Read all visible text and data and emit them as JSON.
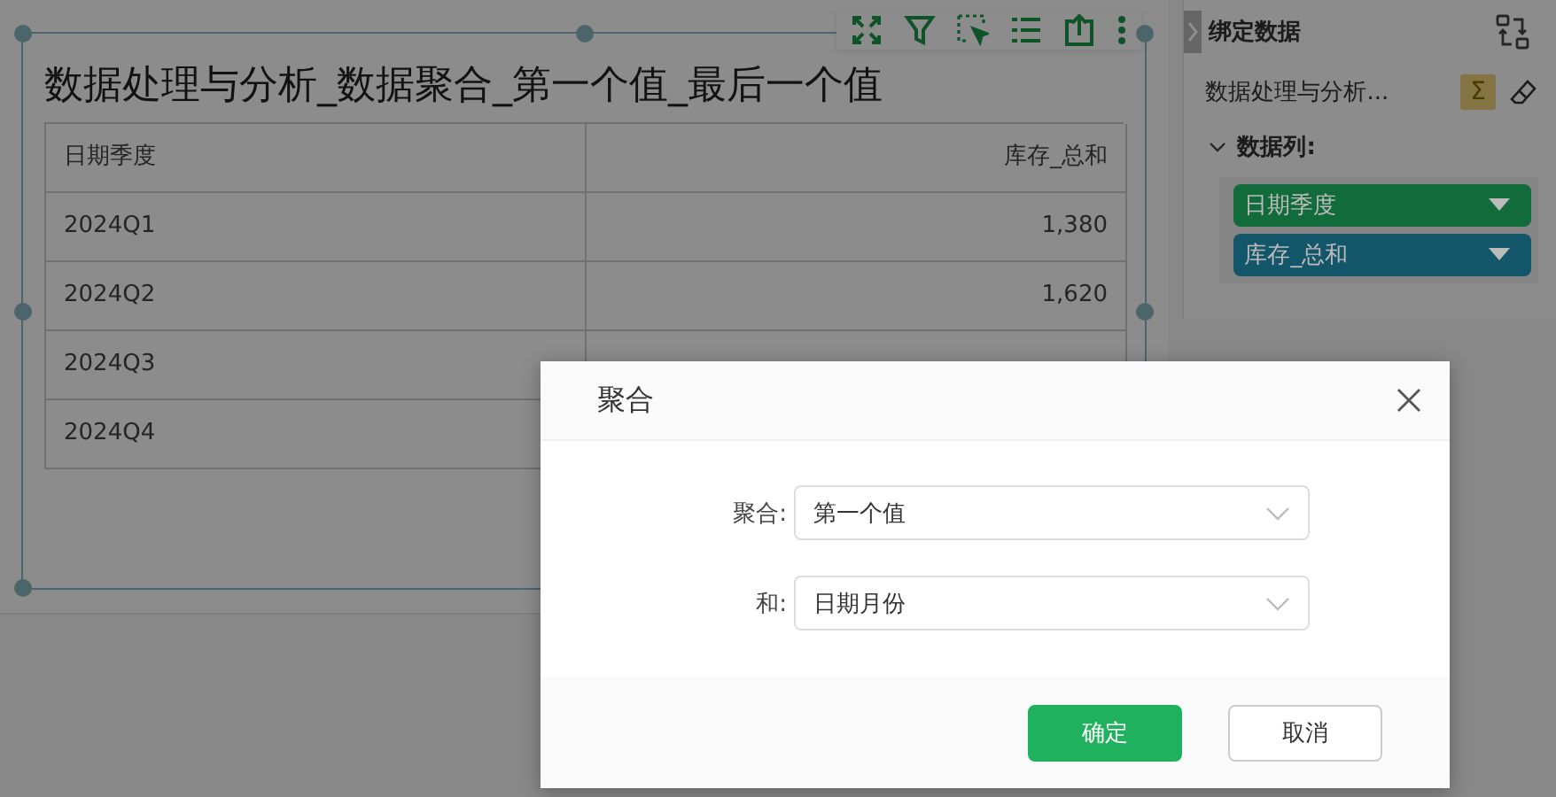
{
  "canvas": {
    "title": "数据处理与分析_数据聚合_第一个值_最后一个值",
    "table": {
      "columns": [
        "日期季度",
        "库存_总和"
      ],
      "rows": [
        [
          "2024Q1",
          "1,380"
        ],
        [
          "2024Q2",
          "1,620"
        ],
        [
          "2024Q3"
        ],
        [
          "2024Q4"
        ]
      ]
    }
  },
  "panel": {
    "title": "绑定数据",
    "dataset": "数据处理与分析...",
    "aggregate_symbol": "Σ",
    "section": {
      "label": "数据列:",
      "expanded": true
    },
    "fields": [
      {
        "label": "日期季度",
        "color": "#116b3a"
      },
      {
        "label": "库存_总和",
        "color": "#145669"
      }
    ]
  },
  "dialog": {
    "title": "聚合",
    "fields": [
      {
        "label": "聚合:",
        "value": "第一个值"
      },
      {
        "label": "和:",
        "value": "日期月份"
      }
    ],
    "buttons": [
      {
        "label": "确定",
        "kind": "primary"
      },
      {
        "label": "取消",
        "kind": "secondary"
      }
    ]
  }
}
